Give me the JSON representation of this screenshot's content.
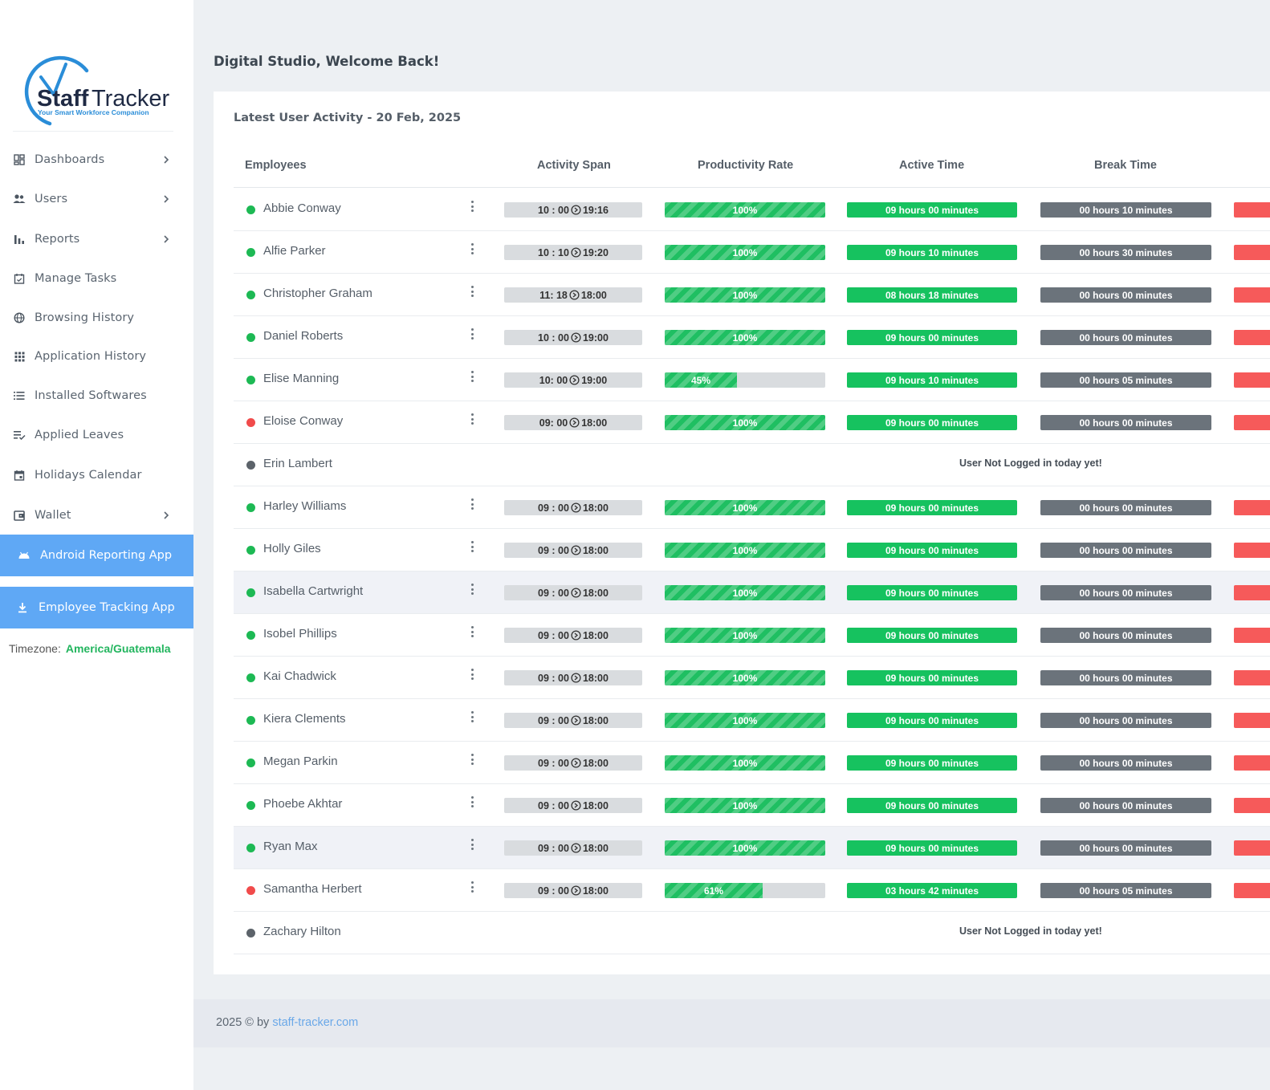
{
  "brand": {
    "logo_text": "Staff Tracker",
    "logo_tagline": "Your Smart Workforce Companion",
    "accent_color": "#2a8dd8"
  },
  "sidebar": {
    "items": [
      {
        "label": "Dashboards",
        "icon": "dashboard-icon",
        "has_submenu": true
      },
      {
        "label": "Users",
        "icon": "users-icon",
        "has_submenu": true
      },
      {
        "label": "Reports",
        "icon": "bar-chart-icon",
        "has_submenu": true
      },
      {
        "label": "Manage Tasks",
        "icon": "calendar-check-icon",
        "has_submenu": false
      },
      {
        "label": "Browsing History",
        "icon": "globe-icon",
        "has_submenu": false
      },
      {
        "label": "Application History",
        "icon": "grid-icon",
        "has_submenu": false
      },
      {
        "label": "Installed Softwares",
        "icon": "list-icon",
        "has_submenu": false
      },
      {
        "label": "Applied Leaves",
        "icon": "playlist-check-icon",
        "has_submenu": false
      },
      {
        "label": "Holidays Calendar",
        "icon": "calendar-icon",
        "has_submenu": false
      },
      {
        "label": "Wallet",
        "icon": "wallet-icon",
        "has_submenu": true
      }
    ],
    "android_app_label": "Android Reporting App",
    "tracking_app_label": "Employee Tracking App",
    "timezone_label": "Timezone:",
    "timezone_value": "America/Guatemala"
  },
  "header": {
    "welcome": "Digital Studio, Welcome Back!"
  },
  "activity": {
    "title": "Latest User Activity - 20 Feb, 2025",
    "columns": [
      "Employees",
      "Activity Span",
      "Productivity Rate",
      "Active Time",
      "Break Time"
    ],
    "not_logged_text": "User Not Logged in today yet!",
    "rows": [
      {
        "name": "Abbie Conway",
        "status": "online",
        "start": "10 : 00",
        "end": "19:16",
        "productivity": 100,
        "productivity_label": "100%",
        "active": "09 hours 00 minutes",
        "break": "00 hours 10 minutes"
      },
      {
        "name": "Alfie Parker",
        "status": "online",
        "start": "10 : 10",
        "end": "19:20",
        "productivity": 100,
        "productivity_label": "100%",
        "active": "09 hours 10 minutes",
        "break": "00 hours 30 minutes"
      },
      {
        "name": "Christopher Graham",
        "status": "online",
        "start": "11: 18",
        "end": "18:00",
        "productivity": 100,
        "productivity_label": "100%",
        "active": "08 hours 18 minutes",
        "break": "00 hours 00 minutes"
      },
      {
        "name": "Daniel Roberts",
        "status": "online",
        "start": "10 : 00",
        "end": "19:00",
        "productivity": 100,
        "productivity_label": "100%",
        "active": "09 hours 00 minutes",
        "break": "00 hours 00 minutes"
      },
      {
        "name": "Elise Manning",
        "status": "online",
        "start": "10: 00",
        "end": "19:00",
        "productivity": 45,
        "productivity_label": "45%",
        "active": "09 hours 10 minutes",
        "break": "00 hours 05 minutes"
      },
      {
        "name": "Eloise Conway",
        "status": "away",
        "start": "09: 00",
        "end": "18:00",
        "productivity": 100,
        "productivity_label": "100%",
        "active": "09 hours 00 minutes",
        "break": "00 hours 00 minutes"
      },
      {
        "name": "Erin Lambert",
        "status": "offline",
        "not_logged": true
      },
      {
        "name": "Harley Williams",
        "status": "online",
        "start": "09 : 00",
        "end": "18:00",
        "productivity": 100,
        "productivity_label": "100%",
        "active": "09 hours 00 minutes",
        "break": "00 hours 00 minutes"
      },
      {
        "name": "Holly Giles",
        "status": "online",
        "start": "09 : 00",
        "end": "18:00",
        "productivity": 100,
        "productivity_label": "100%",
        "active": "09 hours 00 minutes",
        "break": "00 hours 00 minutes"
      },
      {
        "name": "Isabella Cartwright",
        "status": "online",
        "highlight": true,
        "start": "09 : 00",
        "end": "18:00",
        "productivity": 100,
        "productivity_label": "100%",
        "active": "09 hours 00 minutes",
        "break": "00 hours 00 minutes"
      },
      {
        "name": "Isobel Phillips",
        "status": "online",
        "start": "09 : 00",
        "end": "18:00",
        "productivity": 100,
        "productivity_label": "100%",
        "active": "09 hours 00 minutes",
        "break": "00 hours 00 minutes"
      },
      {
        "name": "Kai Chadwick",
        "status": "online",
        "start": "09 : 00",
        "end": "18:00",
        "productivity": 100,
        "productivity_label": "100%",
        "active": "09 hours 00 minutes",
        "break": "00 hours 00 minutes"
      },
      {
        "name": "Kiera Clements",
        "status": "online",
        "start": "09 : 00",
        "end": "18:00",
        "productivity": 100,
        "productivity_label": "100%",
        "active": "09 hours 00 minutes",
        "break": "00 hours 00 minutes"
      },
      {
        "name": "Megan Parkin",
        "status": "online",
        "start": "09 : 00",
        "end": "18:00",
        "productivity": 100,
        "productivity_label": "100%",
        "active": "09 hours 00 minutes",
        "break": "00 hours 00 minutes"
      },
      {
        "name": "Phoebe Akhtar",
        "status": "online",
        "start": "09 : 00",
        "end": "18:00",
        "productivity": 100,
        "productivity_label": "100%",
        "active": "09 hours 00 minutes",
        "break": "00 hours 00 minutes"
      },
      {
        "name": "Ryan Max",
        "status": "online",
        "highlight": true,
        "start": "09 : 00",
        "end": "18:00",
        "productivity": 100,
        "productivity_label": "100%",
        "active": "09 hours 00 minutes",
        "break": "00 hours 00 minutes"
      },
      {
        "name": "Samantha Herbert",
        "status": "away",
        "start": "09 : 00",
        "end": "18:00",
        "productivity": 61,
        "productivity_label": "61%",
        "active": "03 hours 42 minutes",
        "break": "00 hours 05 minutes"
      },
      {
        "name": "Zachary Hilton",
        "status": "offline",
        "not_logged": true
      }
    ]
  },
  "status_colors": {
    "online": "#1db954",
    "away": "#f14b4b",
    "offline": "#5c636a"
  },
  "footer": {
    "prefix": "2025 © by",
    "link_text": "staff-tracker.com"
  }
}
